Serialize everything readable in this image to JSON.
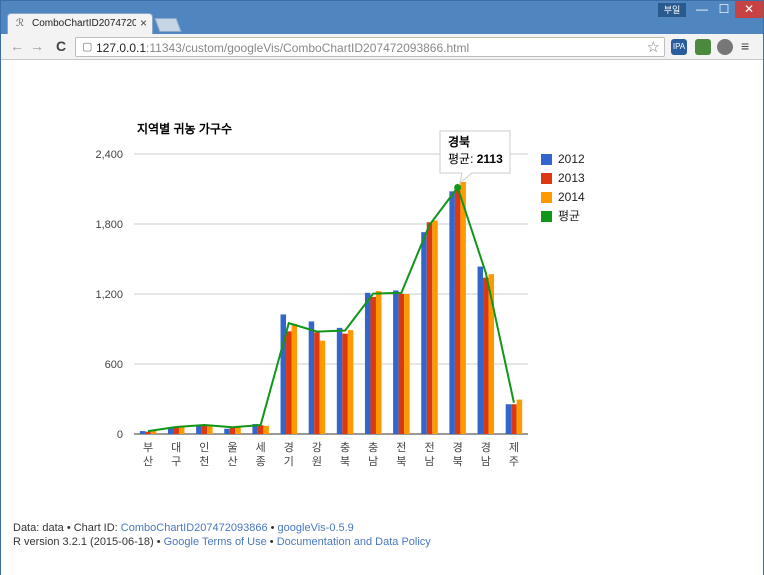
{
  "browser": {
    "tab_title": "ComboChartID20747209",
    "tab_close": "×",
    "user_badge": "부일",
    "url_host": "127.0.0.1",
    "url_rest": ":11343/custom/googleVis/ComboChartID207472093866.html",
    "window_minimize": "—",
    "window_maximize": "☐",
    "window_close": "✕",
    "back_glyph": "←",
    "forward_glyph": "→",
    "reload_glyph": "C",
    "star_glyph": "☆",
    "menu_glyph": "≡",
    "ext_ipa_label": "IPA"
  },
  "chart_data": {
    "type": "bar",
    "title": "지역별 귀농 가구수",
    "categories": [
      "부산",
      "대구",
      "인천",
      "울산",
      "세종",
      "경기",
      "강원",
      "충북",
      "충남",
      "전북",
      "전남",
      "경북",
      "경남",
      "제주"
    ],
    "category_lines": [
      [
        "부",
        "산"
      ],
      [
        "대",
        "구"
      ],
      [
        "인",
        "천"
      ],
      [
        "울",
        "산"
      ],
      [
        "세",
        "종"
      ],
      [
        "경",
        "기"
      ],
      [
        "강",
        "원"
      ],
      [
        "충",
        "북"
      ],
      [
        "충",
        "남"
      ],
      [
        "전",
        "북"
      ],
      [
        "전",
        "남"
      ],
      [
        "경",
        "북"
      ],
      [
        "경",
        "남"
      ],
      [
        "제",
        "주"
      ]
    ],
    "series": [
      {
        "name": "2012",
        "type": "bar",
        "color": "#3366cc",
        "values": [
          25,
          55,
          75,
          45,
          85,
          1025,
          965,
          910,
          1210,
          1230,
          1730,
          2080,
          1435,
          255
        ]
      },
      {
        "name": "2013",
        "type": "bar",
        "color": "#dc3912",
        "values": [
          20,
          55,
          75,
          60,
          75,
          880,
          870,
          860,
          1175,
          1200,
          1815,
          2090,
          1340,
          255
        ]
      },
      {
        "name": "2014",
        "type": "bar",
        "color": "#ff9900",
        "values": [
          30,
          70,
          80,
          70,
          70,
          945,
          800,
          890,
          1225,
          1200,
          1830,
          2160,
          1370,
          295
        ]
      },
      {
        "name": "평균",
        "type": "line",
        "color": "#109618",
        "values": [
          25,
          60,
          77,
          58,
          77,
          950,
          878,
          887,
          1203,
          1210,
          1792,
          2113,
          1382,
          268
        ]
      }
    ],
    "ylim": [
      0,
      2400
    ],
    "y_ticks": [
      "0",
      "600",
      "1,200",
      "1,800",
      "2,400"
    ],
    "y_tick_values": [
      0,
      600,
      1200,
      1800,
      2400
    ],
    "grid": true,
    "legend_position": "right",
    "tooltip": {
      "category": "경북",
      "series_label": "평균:",
      "value": "2113"
    }
  },
  "footer": {
    "line1_prefix": "Data: data • Chart ID: ",
    "chart_id_link": "ComboChartID207472093866",
    "sep1": " • ",
    "googlevis_link": "googleVis-0.5.9",
    "line2_prefix": "R version 3.2.1 (2015-06-18) • ",
    "terms_link": "Google Terms of Use",
    "sep2": " • ",
    "policy_link": "Documentation and Data Policy"
  }
}
